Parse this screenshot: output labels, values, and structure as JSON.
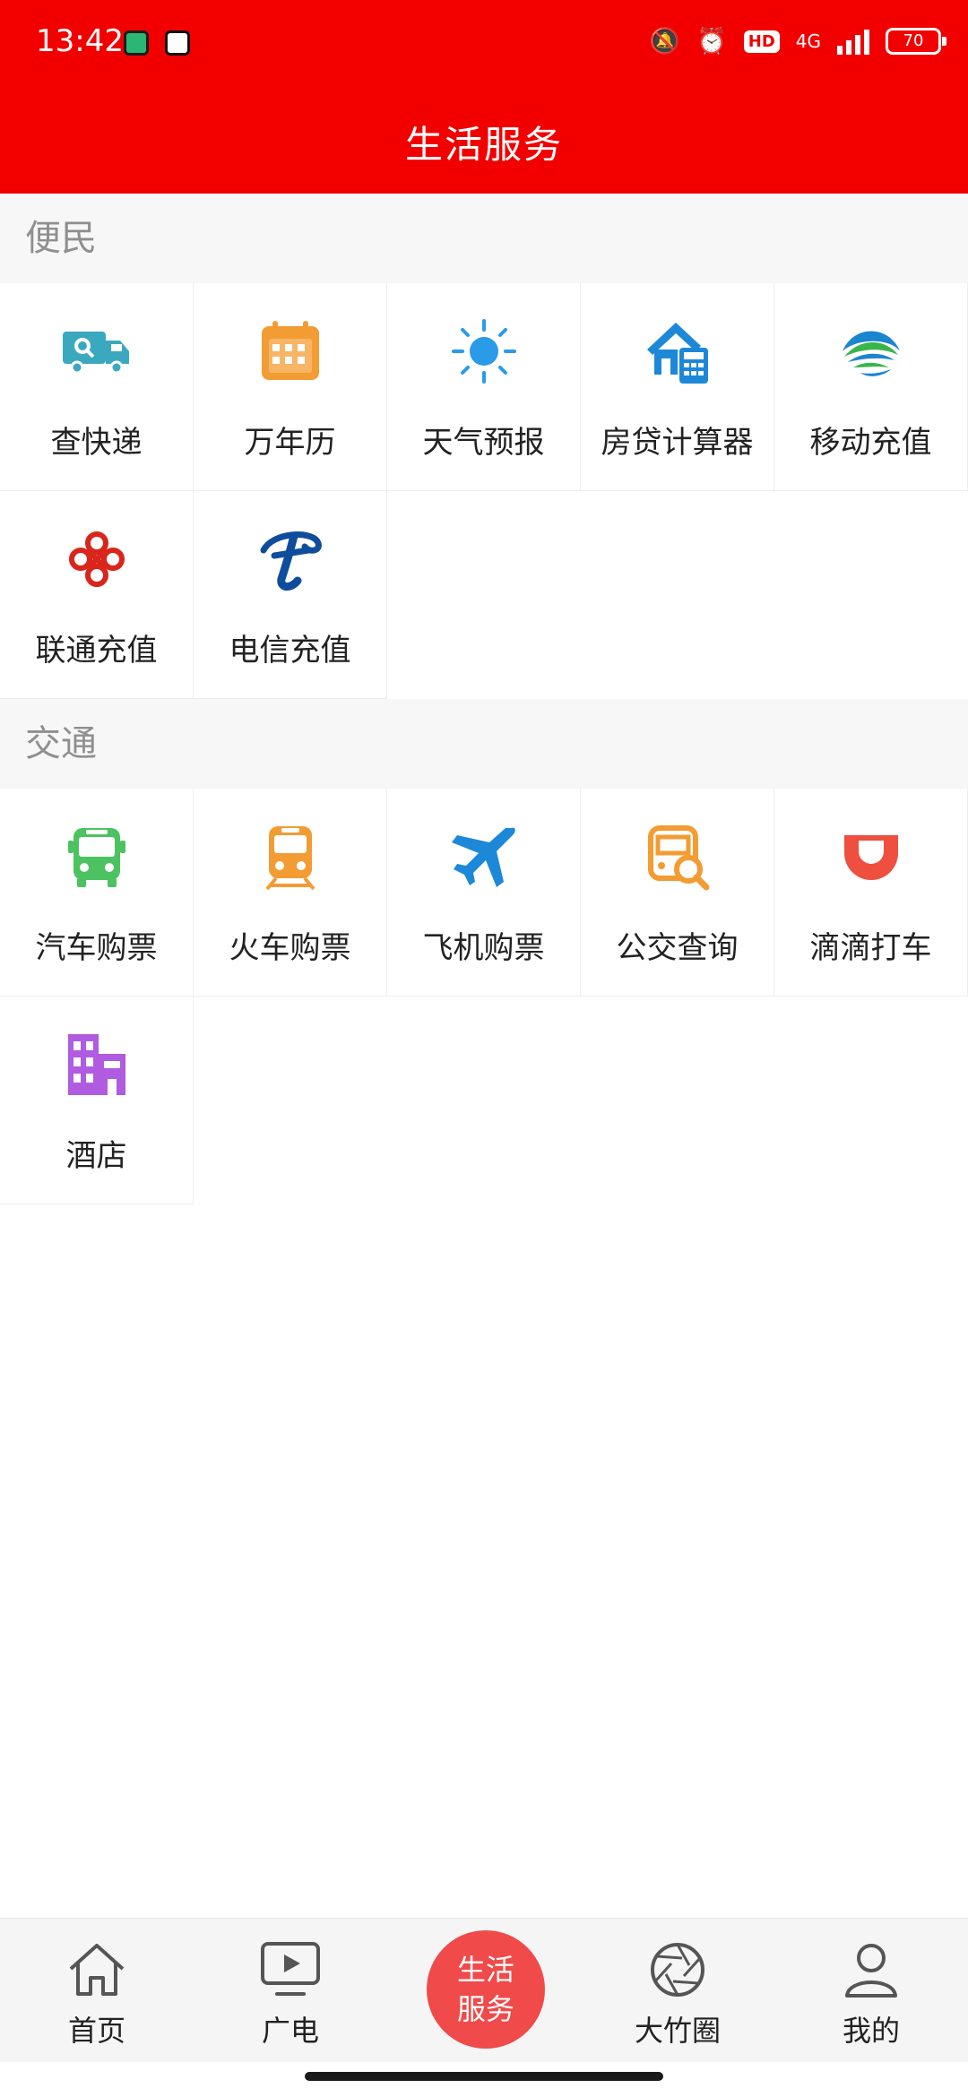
{
  "status_bar": {
    "time": "13:42",
    "hd": "HD",
    "network": "4G",
    "battery": "70"
  },
  "header": {
    "title": "生活服务"
  },
  "sections": [
    {
      "label": "便民",
      "items": [
        {
          "label": "查快递",
          "icon": "delivery-truck-icon"
        },
        {
          "label": "万年历",
          "icon": "calendar-icon"
        },
        {
          "label": "天气预报",
          "icon": "sun-icon"
        },
        {
          "label": "房贷计算器",
          "icon": "house-calculator-icon"
        },
        {
          "label": "移动充值",
          "icon": "china-mobile-icon"
        },
        {
          "label": "联通充值",
          "icon": "china-unicom-icon"
        },
        {
          "label": "电信充值",
          "icon": "china-telecom-icon"
        }
      ]
    },
    {
      "label": "交通",
      "items": [
        {
          "label": "汽车购票",
          "icon": "bus-icon"
        },
        {
          "label": "火车购票",
          "icon": "train-icon"
        },
        {
          "label": "飞机购票",
          "icon": "airplane-icon"
        },
        {
          "label": "公交查询",
          "icon": "bus-search-icon"
        },
        {
          "label": "滴滴打车",
          "icon": "didi-icon"
        },
        {
          "label": "酒店",
          "icon": "hotel-icon"
        }
      ]
    }
  ],
  "bottom_nav": {
    "items": [
      {
        "label": "首页",
        "icon": "home-icon"
      },
      {
        "label": "广电",
        "icon": "tv-play-icon"
      },
      {
        "label": "大竹圈",
        "icon": "aperture-icon"
      },
      {
        "label": "我的",
        "icon": "person-icon"
      }
    ],
    "center_line1": "生活",
    "center_line2": "服务"
  },
  "colors": {
    "header_bg": "#f20000",
    "center_button": "#f04a4a",
    "section_bg": "#f7f7f7"
  }
}
